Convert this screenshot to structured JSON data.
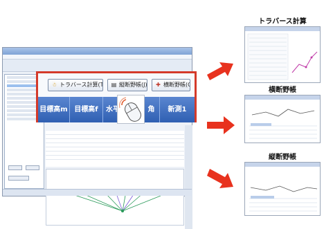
{
  "callout": {
    "buttons": [
      {
        "label": "トラバース計算(T)",
        "icon": "bell-icon"
      },
      {
        "label": "縦断野帳(J)",
        "icon": "chart-icon"
      },
      {
        "label": "横断野帳(O)",
        "icon": "cross-icon"
      }
    ],
    "headers": [
      "目標高m",
      "目標高f",
      "水平",
      "角",
      "新測1"
    ]
  },
  "panels": [
    {
      "title": "トラバース計算"
    },
    {
      "title": "横断野帳"
    },
    {
      "title": "縦断野帳"
    }
  ],
  "colors": {
    "highlight": "#d43a2a",
    "arrow": "#e8321e",
    "header": "#2f5fb2"
  }
}
